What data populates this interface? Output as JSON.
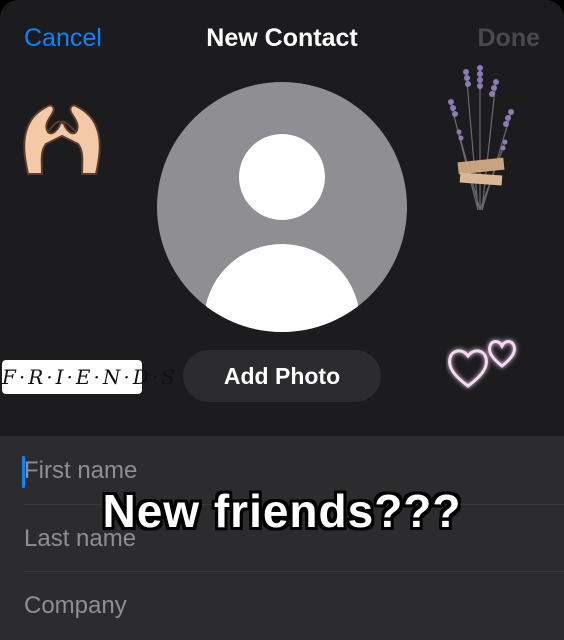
{
  "nav": {
    "cancel_label": "Cancel",
    "title": "New Contact",
    "done_label": "Done"
  },
  "photo": {
    "add_photo_label": "Add Photo"
  },
  "form": {
    "first_name_placeholder": "First name",
    "last_name_placeholder": "Last name",
    "company_placeholder": "Company"
  },
  "stickers": {
    "friends_text": "F·R·I·E·N·D·S",
    "hands_icon": "heart-hands-icon",
    "lavender_icon": "lavender-bouquet-icon",
    "hearts_icon": "neon-hearts-icon"
  },
  "overlay": {
    "caption": "New friends???"
  },
  "colors": {
    "accent": "#0a84ff",
    "background": "#1c1c1e",
    "field_background": "#2c2c2e",
    "placeholder": "#8e8e93",
    "done_disabled": "#4a4a4e"
  }
}
